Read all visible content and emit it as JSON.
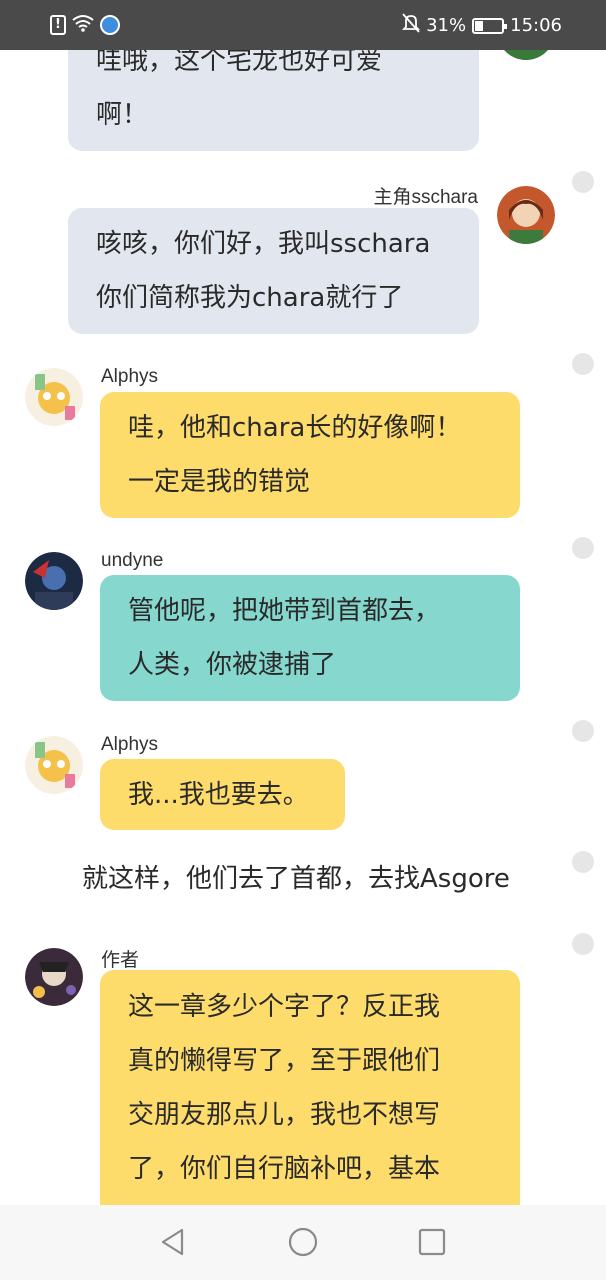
{
  "status_bar": {
    "battery_percent": "31%",
    "time": "15:06",
    "battery_level": 0.31,
    "icons": [
      "alert-icon",
      "wifi-icon",
      "app-icon",
      "mute-icon",
      "battery-icon"
    ]
  },
  "messages": [
    {
      "sender": "",
      "lines": [
        "哇哦，这个宅龙也好可爱",
        "啊！"
      ]
    },
    {
      "sender": "主角sschara",
      "lines": [
        "咳咳，你们好，我叫sschara",
        "你们简称我为chara就行了"
      ]
    },
    {
      "sender": "Alphys",
      "lines": [
        "哇，他和chara长的好像啊！",
        "一定是我的错觉"
      ]
    },
    {
      "sender": "undyne",
      "lines": [
        "管他呢，把她带到首都去，",
        "人类，你被逮捕了"
      ]
    },
    {
      "sender": "Alphys",
      "lines": [
        "我...我也要去。"
      ]
    },
    {
      "sender": "作者",
      "lines": [
        "这一章多少个字了？反正我",
        "真的懒得写了，至于跟他们",
        "交朋友那点儿，我也不想写",
        "了，你们自行脑补吧，基本"
      ]
    }
  ],
  "narration": "就这样，他们去了首都，去找Asgore",
  "colors": {
    "grey_bubble": "#e2e7ef",
    "yellow_bubble": "#fddc6c",
    "teal_bubble": "#86d8cf",
    "status_bar": "#4a4a4a"
  },
  "nav_bar": {
    "icons": [
      "back-icon",
      "home-icon",
      "recents-icon"
    ]
  }
}
